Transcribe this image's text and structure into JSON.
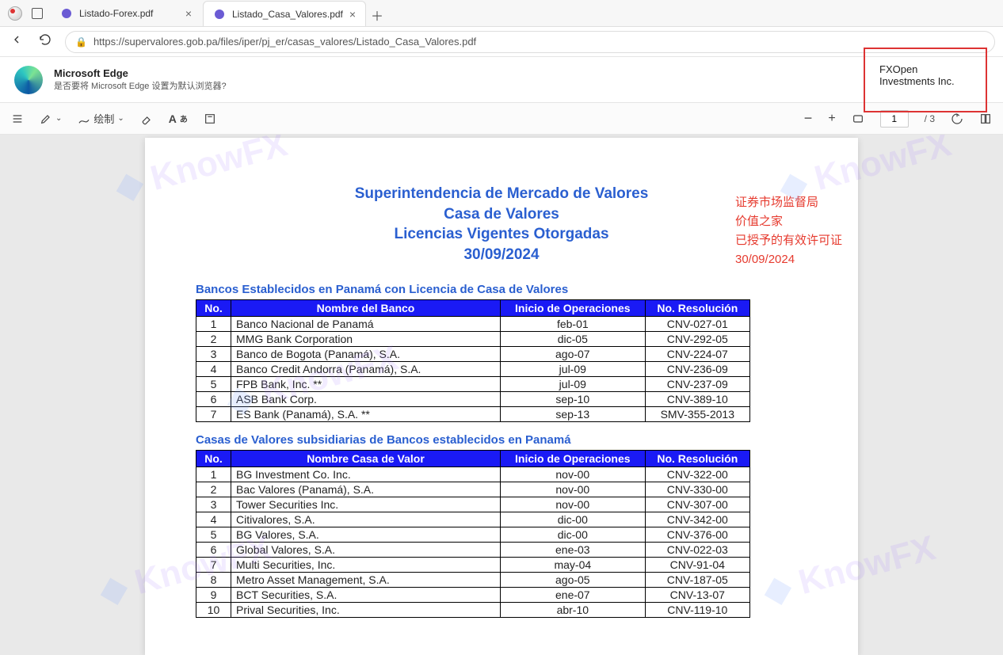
{
  "tabs": [
    {
      "title": "Listado-Forex.pdf",
      "active": false
    },
    {
      "title": "Listado_Casa_Valores.pdf",
      "active": true
    }
  ],
  "url": "https://supervalores.gob.pa/files/iper/pj_er/casas_valores/Listado_Casa_Valores.pdf",
  "infobar": {
    "title": "Microsoft Edge",
    "subtitle": "是否要将 Microsoft Edge 设置为默认浏览器?"
  },
  "pdfbar": {
    "draw_label": "绘制",
    "page_value": "1",
    "page_total": "/ 3"
  },
  "callout": "FXOpen Investments Inc.",
  "watermark": "KnowFX",
  "doc": {
    "title_lines": [
      "Superintendencia de Mercado de Valores",
      "Casa de Valores",
      "Licencias  Vigentes Otorgadas",
      "30/09/2024"
    ],
    "translation_lines": [
      "证券市场监督局",
      "价值之家",
      "已授予的有效许可证",
      "30/09/2024"
    ],
    "section1": {
      "heading": "Bancos Establecidos en Panamá con Licencia de Casa de Valores",
      "headers": [
        "No.",
        "Nombre del Banco",
        "Inicio de Operaciones",
        "No. Resolución"
      ],
      "rows": [
        [
          "1",
          "Banco Nacional de Panamá",
          "feb-01",
          "CNV-027-01"
        ],
        [
          "2",
          "MMG Bank Corporation",
          "dic-05",
          "CNV-292-05"
        ],
        [
          "3",
          "Banco de Bogota (Panamá), S.A.",
          "ago-07",
          "CNV-224-07"
        ],
        [
          "4",
          "Banco Credit Andorra (Panamá), S.A.",
          "jul-09",
          "CNV-236-09"
        ],
        [
          "5",
          "FPB Bank, Inc. **",
          "jul-09",
          "CNV-237-09"
        ],
        [
          "6",
          "ASB Bank Corp.",
          "sep-10",
          "CNV-389-10"
        ],
        [
          "7",
          "ES Bank (Panamá), S.A. **",
          "sep-13",
          "SMV-355-2013"
        ]
      ]
    },
    "section2": {
      "heading": "Casas de Valores  subsidiarias  de Bancos establecidos en Panamá",
      "headers": [
        "No.",
        "Nombre Casa de Valor",
        "Inicio de Operaciones",
        "No. Resolución"
      ],
      "rows": [
        [
          "1",
          "BG Investment Co. Inc.",
          "nov-00",
          "CNV-322-00"
        ],
        [
          "2",
          "Bac Valores (Panamá), S.A.",
          "nov-00",
          "CNV-330-00"
        ],
        [
          "3",
          "Tower Securities Inc.",
          "nov-00",
          "CNV-307-00"
        ],
        [
          "4",
          "Citivalores, S.A.",
          "dic-00",
          "CNV-342-00"
        ],
        [
          "5",
          "BG Valores, S.A.",
          "dic-00",
          "CNV-376-00"
        ],
        [
          "6",
          "Global Valores, S.A.",
          "ene-03",
          "CNV-022-03"
        ],
        [
          "7",
          "Multi Securities, Inc.",
          "may-04",
          "CNV-91-04"
        ],
        [
          "8",
          "Metro Asset Management, S.A.",
          "ago-05",
          "CNV-187-05"
        ],
        [
          "9",
          "BCT Securities, S.A.",
          "ene-07",
          "CNV-13-07"
        ],
        [
          "10",
          "Prival Securities, Inc.",
          "abr-10",
          "CNV-119-10"
        ]
      ]
    }
  }
}
